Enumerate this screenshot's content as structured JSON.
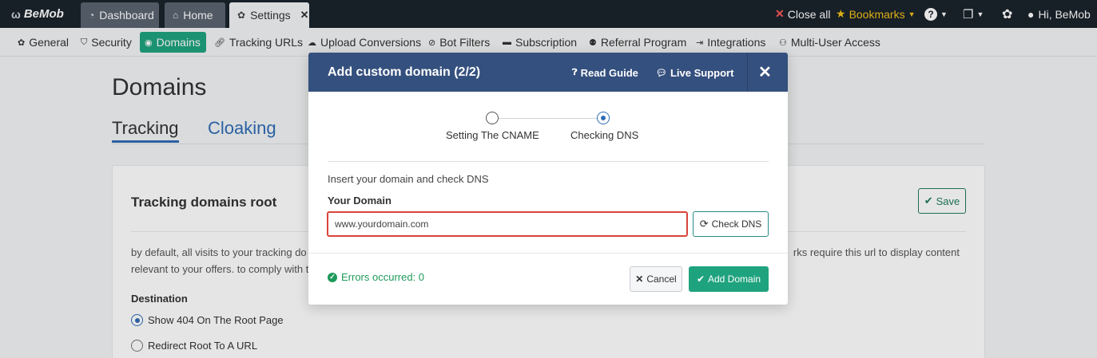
{
  "topbar": {
    "logo": "BeMob",
    "tabs": [
      {
        "label": "Dashboard",
        "icon": "dashboard-icon"
      },
      {
        "label": "Home",
        "icon": "home-icon"
      },
      {
        "label": "Settings",
        "icon": "gear-icon"
      }
    ],
    "close_all": "Close all",
    "bookmarks": "Bookmarks",
    "user_greeting": "Hi, BeMob"
  },
  "subnav": {
    "items": [
      {
        "label": "General",
        "icon": "gear-icon"
      },
      {
        "label": "Security",
        "icon": "shield-icon"
      },
      {
        "label": "Domains",
        "icon": "globe-icon"
      },
      {
        "label": "Tracking URLs",
        "icon": "link-icon"
      },
      {
        "label": "Upload Conversions",
        "icon": "cloud-upload-icon"
      },
      {
        "label": "Bot Filters",
        "icon": "ban-icon"
      },
      {
        "label": "Subscription",
        "icon": "card-icon"
      },
      {
        "label": "Referral Program",
        "icon": "users-icon"
      },
      {
        "label": "Integrations",
        "icon": "plug-icon"
      },
      {
        "label": "Multi-User Access",
        "icon": "user-group-icon"
      }
    ],
    "active": "Domains"
  },
  "page": {
    "title": "Domains",
    "tabs": [
      "Tracking",
      "Cloaking"
    ],
    "card_title": "Tracking domains root",
    "save": "Save",
    "desc_left": "by default, all visits to your tracking do",
    "desc_right": "rks require this url to display content",
    "desc_line2": "relevant to your offers. to comply with t",
    "destination_label": "Destination",
    "options": [
      "Show 404 On The Root Page",
      "Redirect Root To A URL"
    ]
  },
  "modal": {
    "title": "Add custom domain (2/2)",
    "read_guide": "Read Guide",
    "live_support": "Live Support",
    "steps": [
      "Setting The CNAME",
      "Checking DNS"
    ],
    "instruction": "Insert your domain and check DNS",
    "field_label": "Your Domain",
    "domain_value": "www.yourdomain.com",
    "check_dns": "Check DNS",
    "errors": "Errors occurred: 0",
    "cancel": "Cancel",
    "add_domain": "Add Domain"
  },
  "colors": {
    "accent_green": "#1fa37e",
    "header_blue": "#34507e",
    "error_red": "#d9443c",
    "topbar": "#1a232c"
  }
}
